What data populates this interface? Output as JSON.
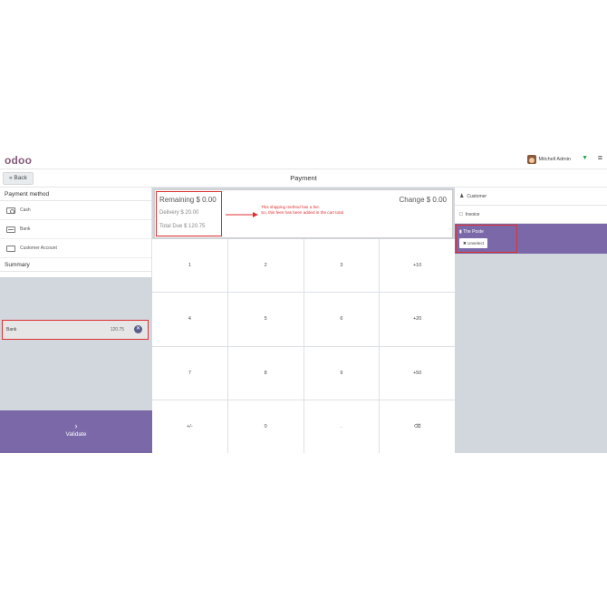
{
  "header": {
    "logo": "odoo",
    "user_name": "Mitchell Admin",
    "wifi_icon": "wifi-icon",
    "menu_icon": "hamburger-icon"
  },
  "subheader": {
    "back_label": "« Back",
    "title": "Payment"
  },
  "left": {
    "payment_method_title": "Payment method",
    "methods": [
      {
        "label": "Cash",
        "icon": "cash-icon"
      },
      {
        "label": "Bank",
        "icon": "bank-icon"
      },
      {
        "label": "Customer Account",
        "icon": "customer-account-icon"
      }
    ],
    "summary_title": "Summary",
    "summary_line": {
      "method": "Bank",
      "amount": "120.75"
    },
    "validate_label": "Validate"
  },
  "payment": {
    "remaining": "Remaining $ 0.00",
    "delivery": "Delivery $ 20.00",
    "total_due": "Total Due $ 120.75",
    "change": "Change $ 0.00",
    "note_line1": "This shipping method has a fee.",
    "note_line2": "So, this fees has been added in the cart total"
  },
  "numpad": [
    "1",
    "2",
    "3",
    "+10",
    "4",
    "5",
    "6",
    "+20",
    "7",
    "8",
    "9",
    "+50",
    "+/-",
    "0",
    ".",
    "⌫"
  ],
  "right": {
    "customer_label": "Customer",
    "invoice_label": "Invoice",
    "carrier_name": "The Poste",
    "unselect_label": "Unselect"
  },
  "colors": {
    "accent": "#7a68a8",
    "highlight": "#e03030",
    "panel_bg": "#d2d6dd"
  }
}
